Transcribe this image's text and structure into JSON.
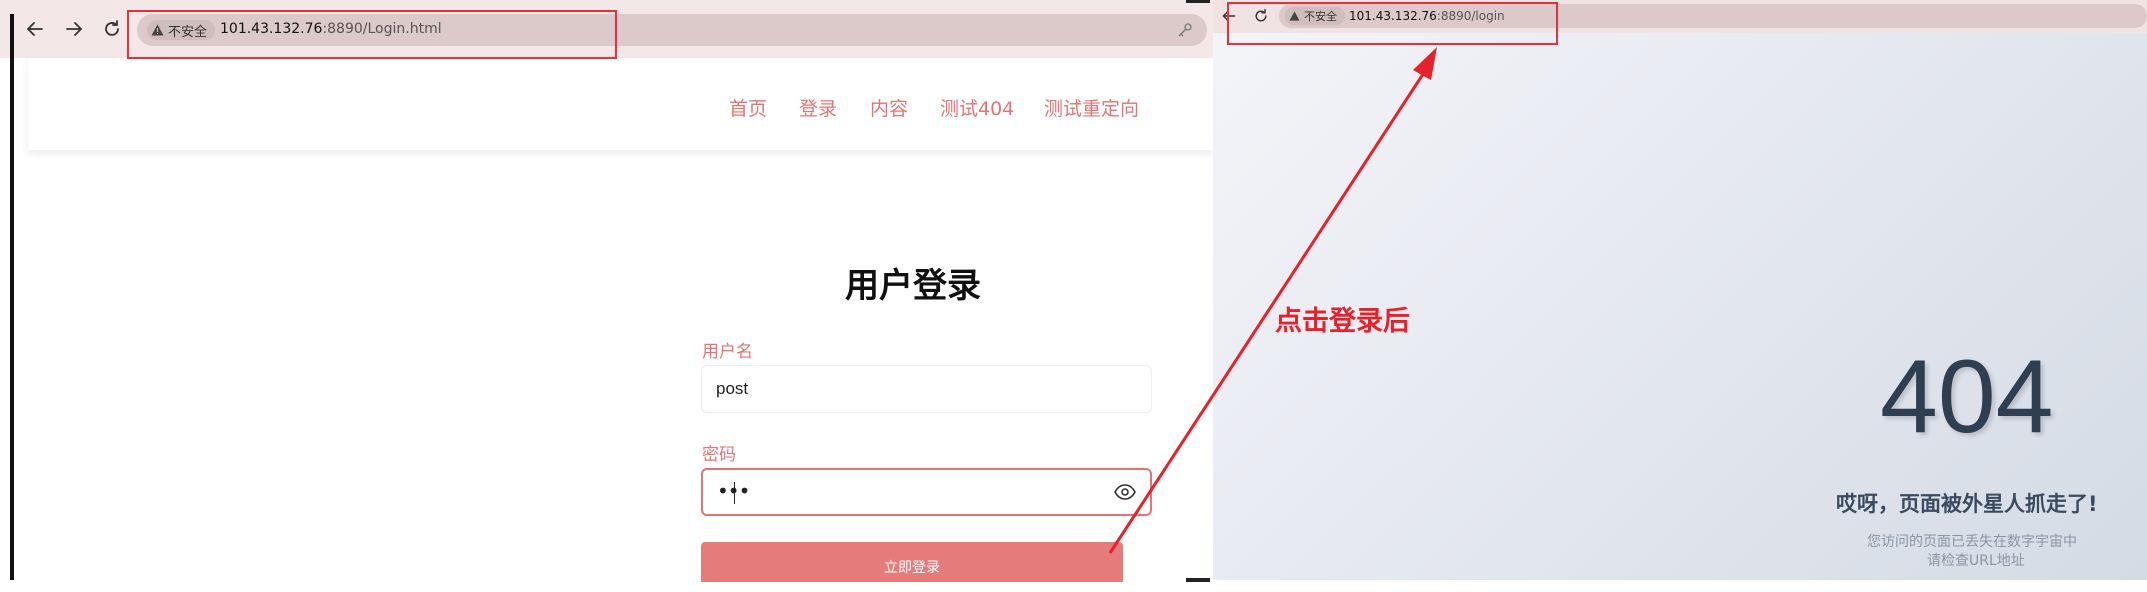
{
  "left_browser": {
    "security_label": "不安全",
    "url_host": "101.43.132.76",
    "url_rest": ":8890/Login.html"
  },
  "site_nav": {
    "items": [
      "首页",
      "登录",
      "内容",
      "测试404",
      "测试重定向"
    ]
  },
  "login_form": {
    "title": "用户登录",
    "username_label": "用户名",
    "username_value": "post",
    "password_label": "密码",
    "password_value": "•••",
    "submit_label": "立即登录"
  },
  "annotation": {
    "text": "点击登录后",
    "color": "#e8202a"
  },
  "right_browser": {
    "security_label": "不安全",
    "url_host": "101.43.132.76",
    "url_rest": ":8890/login"
  },
  "error_page": {
    "code": "404",
    "title": "哎呀，页面被外星人抓走了!",
    "desc_line1": "您访问的页面已丢失在数字宇宙中",
    "desc_line2": "请检查URL地址"
  },
  "colors": {
    "accent": "#e57373",
    "highlight_box": "#e8303a",
    "error_text": "#2e3f52"
  }
}
